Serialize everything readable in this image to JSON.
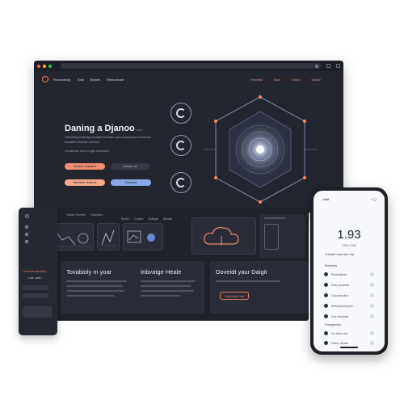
{
  "browser": {
    "nav_left": [
      "Rotobaskog",
      "Tosti",
      "Bostes",
      "Retobakuse"
    ],
    "nav_right": [
      "Rewjesk",
      "Balo",
      "Ostyo",
      "Dause"
    ],
    "hero_title": "Daning a Djanoo",
    "hero_title_suffix": "nteo",
    "hero_desc": "Trihewaing boskodg crovastia totohalls u gue seoquenqe brotodenoa brloasttin urlanotie sonhnes",
    "hero_desc2": "Lenasenlos dros ec agle thovaenrs.",
    "buttons": [
      "Gesttoni Esplaans",
      "Gisaaao ae"
    ],
    "buttons2": [
      "Bsbotnan Gottions",
      "Cisdboaer"
    ]
  },
  "dashboard": {
    "top_tabs": [
      "Gellots Tamedu",
      "Sdboiarrs"
    ],
    "top_tabs2": [
      "Boutkr",
      "Gotlent",
      "Balfogis",
      "Banatd"
    ],
    "cards": [
      {
        "title": "Tovabioly m yoar"
      },
      {
        "title": "Inbvatge Heale"
      },
      {
        "title": "Doveidt yaur Daigit",
        "button": "Galtuerbe ent"
      }
    ]
  },
  "tablet": {
    "title": "Usmaiendcotlas",
    "sub": "Lde, aob"
  },
  "phone": {
    "status_left": "Uadt",
    "big_value": "1.93",
    "sub_value": "SSM-45f6",
    "link": "Tranael dosi dan mp",
    "section1": "Rnaders",
    "section2": "Parsgectiur",
    "items": [
      "Pacaacjleas",
      "Dosc poutasls",
      "Cuscleeadlos",
      "Ibetsohpoeliopbe",
      "Dos hesdatas",
      "Do sitbue elc",
      "Pakse dlosas"
    ]
  }
}
